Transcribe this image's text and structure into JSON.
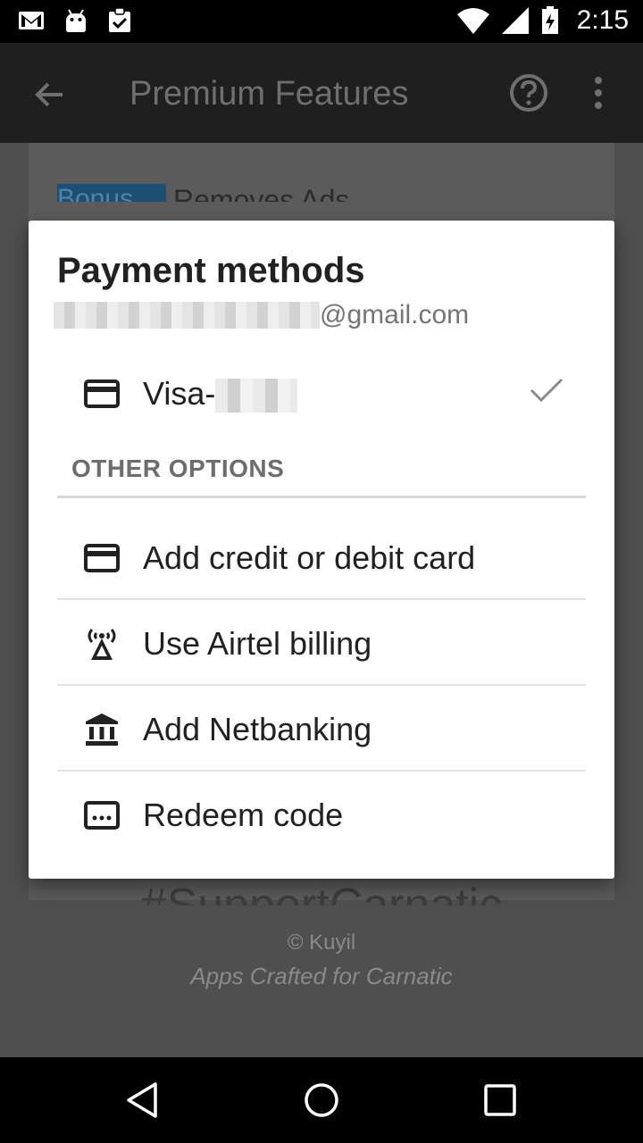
{
  "status_bar": {
    "time": "2:15",
    "icons": [
      "gmail-icon",
      "android-icon",
      "clipboard-check-icon",
      "wifi-icon",
      "cell-signal-icon",
      "battery-icon"
    ]
  },
  "app_bar": {
    "title": "Premium Features",
    "icons": [
      "back-arrow-icon",
      "help-icon",
      "more-vert-icon"
    ]
  },
  "background": {
    "bonus_badge": "Bonus",
    "bonus_text": "Removes Ads",
    "hashtag": "#SupportCarnatic",
    "copyright": "© Kuyil",
    "tagline": "Apps Crafted for Carnatic"
  },
  "dialog": {
    "title": "Payment methods",
    "email_domain": "@gmail.com",
    "selected_method": {
      "label_prefix": "Visa-",
      "icon": "credit-card-icon",
      "selected": true
    },
    "section_header": "OTHER OPTIONS",
    "options": [
      {
        "label": "Add credit or debit card",
        "icon": "credit-card-icon"
      },
      {
        "label": "Use Airtel billing",
        "icon": "cell-tower-icon"
      },
      {
        "label": "Add Netbanking",
        "icon": "bank-icon"
      },
      {
        "label": "Redeem code",
        "icon": "redeem-code-icon"
      }
    ]
  },
  "nav_bar": {
    "icons": [
      "nav-back-icon",
      "nav-home-icon",
      "nav-recent-icon"
    ]
  },
  "colors": {
    "dialog_bg": "#ffffff",
    "title_text": "#212121",
    "secondary_text": "#757575",
    "scrim": "#4f4f4f"
  }
}
